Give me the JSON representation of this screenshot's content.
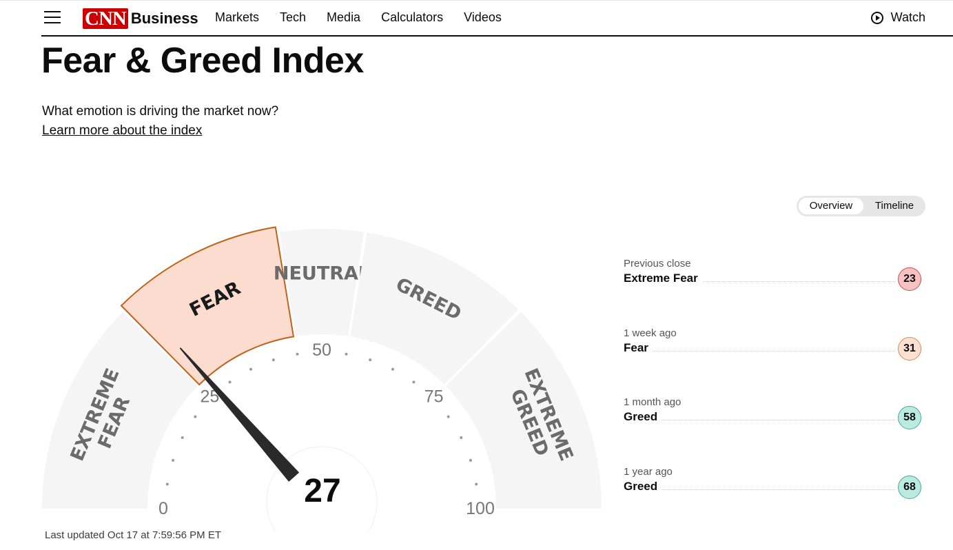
{
  "header": {
    "logo_mark": "CNN",
    "logo_text": "Business",
    "nav": [
      "Markets",
      "Tech",
      "Media",
      "Calculators",
      "Videos"
    ],
    "watch_label": "Watch"
  },
  "page": {
    "title": "Fear & Greed Index",
    "subtitle": "What emotion is driving the market now?",
    "learn_link": "Learn more about the index"
  },
  "toggle": {
    "active": "Overview",
    "other": "Timeline"
  },
  "gauge": {
    "value": 27,
    "value_label": "27",
    "active_segment": "Fear",
    "ticks": [
      "0",
      "25",
      "50",
      "75",
      "100"
    ],
    "segments": [
      {
        "label": "EXTREME FEAR",
        "from": 0,
        "to": 25
      },
      {
        "label": "FEAR",
        "from": 25,
        "to": 45
      },
      {
        "label": "NEUTRAL",
        "from": 45,
        "to": 55
      },
      {
        "label": "GREED",
        "from": 55,
        "to": 75
      },
      {
        "label": "EXTREME GREED",
        "from": 75,
        "to": 100
      }
    ],
    "updated": "Last updated Oct 17 at 7:59:56 PM ET"
  },
  "history": [
    {
      "when": "Previous close",
      "label": "Extreme Fear",
      "value": "23",
      "bg": "#f9c2c2",
      "border": "#c94b4b"
    },
    {
      "when": "1 week ago",
      "label": "Fear",
      "value": "31",
      "bg": "#fde0d1",
      "border": "#d8875a"
    },
    {
      "when": "1 month ago",
      "label": "Greed",
      "value": "58",
      "bg": "#b9ebe0",
      "border": "#4aa894"
    },
    {
      "when": "1 year ago",
      "label": "Greed",
      "value": "68",
      "bg": "#b9ebe0",
      "border": "#4aa894"
    }
  ],
  "colors": {
    "segment_fill": "#f5f5f5",
    "active_fill": "#fddcd0",
    "active_stroke": "#c0621a",
    "segment_text": "#6b6b6b",
    "needle": "#2a2a2a",
    "brand": "#cc0000"
  }
}
